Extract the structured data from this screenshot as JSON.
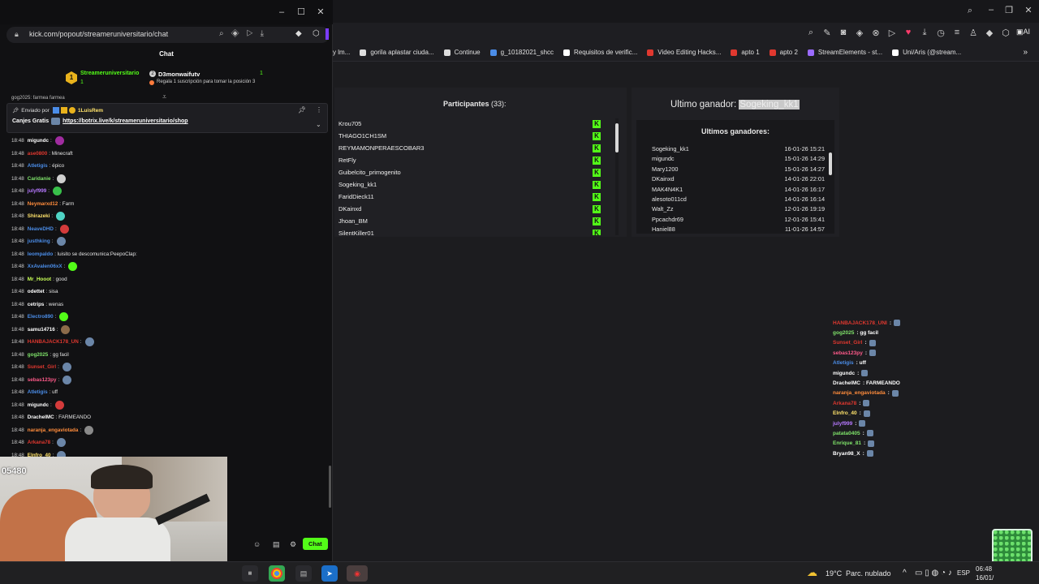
{
  "left_window": {
    "url": "kick.com/popout/streameruniversitario/chat",
    "chat_title": "Chat",
    "sub_leader": {
      "name": "Streameruniversitario",
      "count": "1"
    },
    "sub_second": {
      "name": "D3monwaifutv",
      "count": "1",
      "note": "Regala 1 suscripción para tomar la posición 3"
    },
    "partial_top": "gog2025: farmea farmea",
    "pinned": {
      "sent_by_label": "Enviado por",
      "sent_by_user": "1LuisRem",
      "label": "Canjes Gratis",
      "link": "https://botrix.live/k/streameruniversitario/shop"
    },
    "messages": [
      {
        "time": "18:48",
        "user": "migundc",
        "color": "#ffffff",
        "text": ":",
        "emote": "#a02ca0"
      },
      {
        "time": "18:48",
        "user": "ase0800",
        "color": "#e0382f",
        "text": ": Minecraft",
        "emote": ""
      },
      {
        "time": "18:48",
        "user": "Atletigis",
        "color": "#4b8de8",
        "text": ": épico",
        "emote": ""
      },
      {
        "time": "18:48",
        "user": "Caridanie",
        "color": "#7fe36a",
        "text": ":",
        "emote": "#cfcfcf"
      },
      {
        "time": "18:48",
        "user": "julyf999",
        "color": "#b678ff",
        "text": ":",
        "emote": "#38c04a"
      },
      {
        "time": "18:48",
        "user": "Neymarxd12",
        "color": "#ff8c3c",
        "text": ": Farm",
        "emote": ""
      },
      {
        "time": "18:48",
        "user": "Shirazeki",
        "color": "#ffe36b",
        "text": ":",
        "emote": "#4fd3c4"
      },
      {
        "time": "18:48",
        "user": "NeaveDHD",
        "color": "#4b8de8",
        "text": ":",
        "emote": "#d43b3b"
      },
      {
        "time": "18:48",
        "user": "justhking",
        "color": "#4b8de8",
        "text": ":",
        "emote": "#6b86a8"
      },
      {
        "time": "18:48",
        "user": "leompaldo",
        "color": "#4b8de8",
        "text": ": luisito se descomunica:PeepoClap:",
        "emote": ""
      },
      {
        "time": "18:48",
        "user": "XxAvalen06xX",
        "color": "#4b8de8",
        "text": ":",
        "emote": "#53fc18"
      },
      {
        "time": "18:48",
        "user": "Mr_Hooot",
        "color": "#c8ff57",
        "text": ": good",
        "emote": ""
      },
      {
        "time": "18:48",
        "user": "odettet",
        "color": "#ffffff",
        "text": ": sisa",
        "emote": ""
      },
      {
        "time": "18:48",
        "user": "cetrips",
        "color": "#ffffff",
        "text": ": wenas",
        "emote": ""
      },
      {
        "time": "18:48",
        "user": "Electro890",
        "color": "#4b8de8",
        "text": ":",
        "emote": "#53fc18"
      },
      {
        "time": "18:48",
        "user": "samu14716",
        "color": "#ffffff",
        "text": ":",
        "emote": "#8c6b4a"
      },
      {
        "time": "18:48",
        "user": "HANBAJACK178_UN",
        "color": "#e0382f",
        "text": ":",
        "emote": "#6b86a8"
      },
      {
        "time": "18:48",
        "user": "gog2025",
        "color": "#7fe36a",
        "text": ": gg facil",
        "emote": ""
      },
      {
        "time": "18:48",
        "user": "Sunset_Girl",
        "color": "#e0382f",
        "text": ":",
        "emote": "#6b86a8"
      },
      {
        "time": "18:48",
        "user": "sebas123py",
        "color": "#ff5a8a",
        "text": ":",
        "emote": "#6b86a8"
      },
      {
        "time": "18:48",
        "user": "Atletigis",
        "color": "#4b8de8",
        "text": ": uff",
        "emote": ""
      },
      {
        "time": "18:48",
        "user": "migundc",
        "color": "#ffffff",
        "text": ":",
        "emote": "#d43b3b"
      },
      {
        "time": "18:48",
        "user": "DrachelMC",
        "color": "#ffffff",
        "text": ": FARMEANDO",
        "emote": ""
      },
      {
        "time": "18:48",
        "user": "naranja_engaviotada",
        "color": "#ff8c3c",
        "text": ":",
        "emote": "#8a8a8a"
      },
      {
        "time": "18:48",
        "user": "Arkana78",
        "color": "#e0382f",
        "text": ":",
        "emote": "#6b86a8"
      },
      {
        "time": "18:48",
        "user": "Elnfro_40",
        "color": "#ffe36b",
        "text": ":",
        "emote": "#6b86a8"
      }
    ],
    "webcam_counter": "05480",
    "chat_button": "Chat"
  },
  "right_browser": {
    "bookmarks": [
      {
        "label": "y lm...",
        "color": "#888888"
      },
      {
        "label": "gorila aplastar ciuda...",
        "color": "#dddddd"
      },
      {
        "label": "Continue",
        "color": "#dddddd"
      },
      {
        "label": "g_10182021_shcc",
        "color": "#4b8de8"
      },
      {
        "label": "Requisitos de verific...",
        "color": "#ffffff"
      },
      {
        "label": "Video Editing Hacks...",
        "color": "#e0382f"
      },
      {
        "label": "apto 1",
        "color": "#e0382f"
      },
      {
        "label": "apto 2",
        "color": "#e0382f"
      },
      {
        "label": "StreamElements - st...",
        "color": "#9b6bff"
      },
      {
        "label": "Uni/Aris (@stream...",
        "color": "#ffffff"
      }
    ]
  },
  "giveaway": {
    "participants_label": "Participantes",
    "participants_count": "(33):",
    "participants": [
      "Krou705",
      "THIAGO1CH1SM",
      "REYMAMONPERAESCOBAR3",
      "RetFly",
      "Guibelcito_primogenito",
      "Sogeking_kk1",
      "FaridDieck11",
      "DKainxd",
      "Jhoan_BM",
      "SilentKiller01"
    ],
    "last_winner_label": "Ultimo ganador:",
    "last_winner": "Sogeking_kk1",
    "winners_title": "Ultimos ganadores:",
    "winners": [
      {
        "name": "Sogeking_kk1",
        "date": "16-01-26 15:21"
      },
      {
        "name": "migundc",
        "date": "15-01-26 14:29"
      },
      {
        "name": "Mary1200",
        "date": "15-01-26 14:27"
      },
      {
        "name": "DKainxd",
        "date": "14-01-26 22:01"
      },
      {
        "name": "MAK4N4K1",
        "date": "14-01-26 16:17"
      },
      {
        "name": "alesoto011cd",
        "date": "14-01-26 16:14"
      },
      {
        "name": "Walt_Zz",
        "date": "12-01-26 19:19"
      },
      {
        "name": "Ppcachdr69",
        "date": "12-01-26 15:41"
      },
      {
        "name": "Haniel88",
        "date": "11-01-26 14:57"
      }
    ]
  },
  "overlay_chat": [
    {
      "user": "HANBAJACK178_UNI",
      "color": "#e0382f",
      "text": ":"
    },
    {
      "user": "gog2025",
      "color": "#7fe36a",
      "text": ": gg facil"
    },
    {
      "user": "Sunset_Girl",
      "color": "#e0382f",
      "text": ":"
    },
    {
      "user": "sebas123py",
      "color": "#ff5a8a",
      "text": ":"
    },
    {
      "user": "Atletigis",
      "color": "#4b8de8",
      "text": ": uff"
    },
    {
      "user": "migundc",
      "color": "#ffffff",
      "text": ":"
    },
    {
      "user": "DrachelMC",
      "color": "#ffffff",
      "text": ": FARMEANDO"
    },
    {
      "user": "naranja_engaviotada",
      "color": "#ff8c3c",
      "text": ":"
    },
    {
      "user": "Arkana78",
      "color": "#e0382f",
      "text": ":"
    },
    {
      "user": "Elnfro_40",
      "color": "#ffe36b",
      "text": ":"
    },
    {
      "user": "julyf999",
      "color": "#b678ff",
      "text": ":"
    },
    {
      "user": "patata0405",
      "color": "#7fe36a",
      "text": ":"
    },
    {
      "user": "Enrique_81",
      "color": "#7fe36a",
      "text": ":"
    },
    {
      "user": "Bryan98_X",
      "color": "#ffffff",
      "text": ":"
    }
  ],
  "taskbar": {
    "weather_temp": "19°C",
    "weather_desc": "Parc. nublado",
    "lang": "ESP",
    "time": "06:48",
    "date": "16/01/"
  }
}
